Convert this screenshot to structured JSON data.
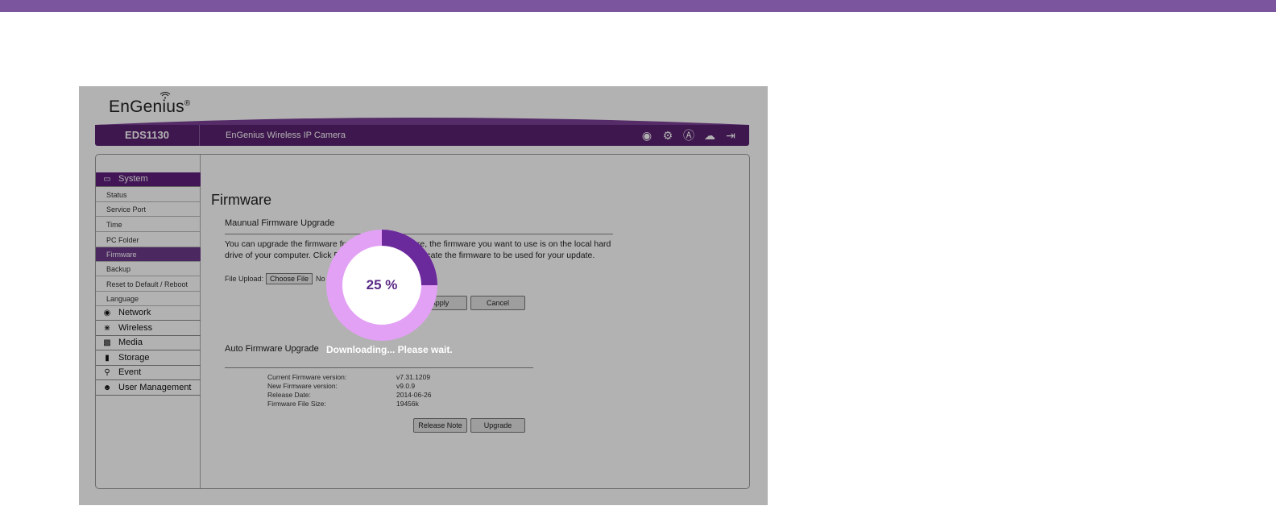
{
  "brand": {
    "logo_text": "EnGenius",
    "logo_reg": "®",
    "model": "EDS1130",
    "product_name": "EnGenius Wireless IP Camera"
  },
  "header_icons": [
    "camera-icon",
    "gear-icon",
    "admin-icon",
    "cloud-upload-icon",
    "logout-icon"
  ],
  "sidebar": {
    "system": "System",
    "system_items": [
      "Status",
      "Service Port",
      "Time",
      "PC Folder",
      "Firmware",
      "Backup",
      "Reset to Default / Reboot",
      "Language"
    ],
    "active_item": "Firmware",
    "sections": [
      "Network",
      "Wireless",
      "Media",
      "Storage",
      "Event",
      "User Management"
    ]
  },
  "page": {
    "title": "Firmware",
    "manual_heading": "Maunual Firmware Upgrade",
    "manual_text": "You can upgrade the firmware from this page. Ensure, the firmware you want to use is on the local hard drive of your computer. Click Browse to browse and locate the firmware to be used for your update.",
    "file_upload_label": "File Upload:",
    "choose_file_label": "Choose File",
    "no_file_label": "No file chosen",
    "apply_label": "Apply",
    "cancel_label": "Cancel",
    "auto_heading": "Auto Firmware Upgrade",
    "current_version_label": "Current Firmware version:",
    "current_version_value": "v7.31.1209",
    "new_version_label": "New Firmware version:",
    "new_version_value": "v9.0.9",
    "release_date_label": "Release Date:",
    "release_date_value": "2014-06-26",
    "file_size_label": "Firmware File Size:",
    "file_size_value": "19456k",
    "release_note_label": "Release Note",
    "upgrade_label": "Upgrade"
  },
  "progress": {
    "percent": 25,
    "percent_text": "25 %",
    "message": "Downloading... Please wait."
  },
  "colors": {
    "accent": "#5a2170",
    "band": "#7c559f",
    "ring_track": "#e3a1f5",
    "ring_fill": "#6a2a9c"
  }
}
